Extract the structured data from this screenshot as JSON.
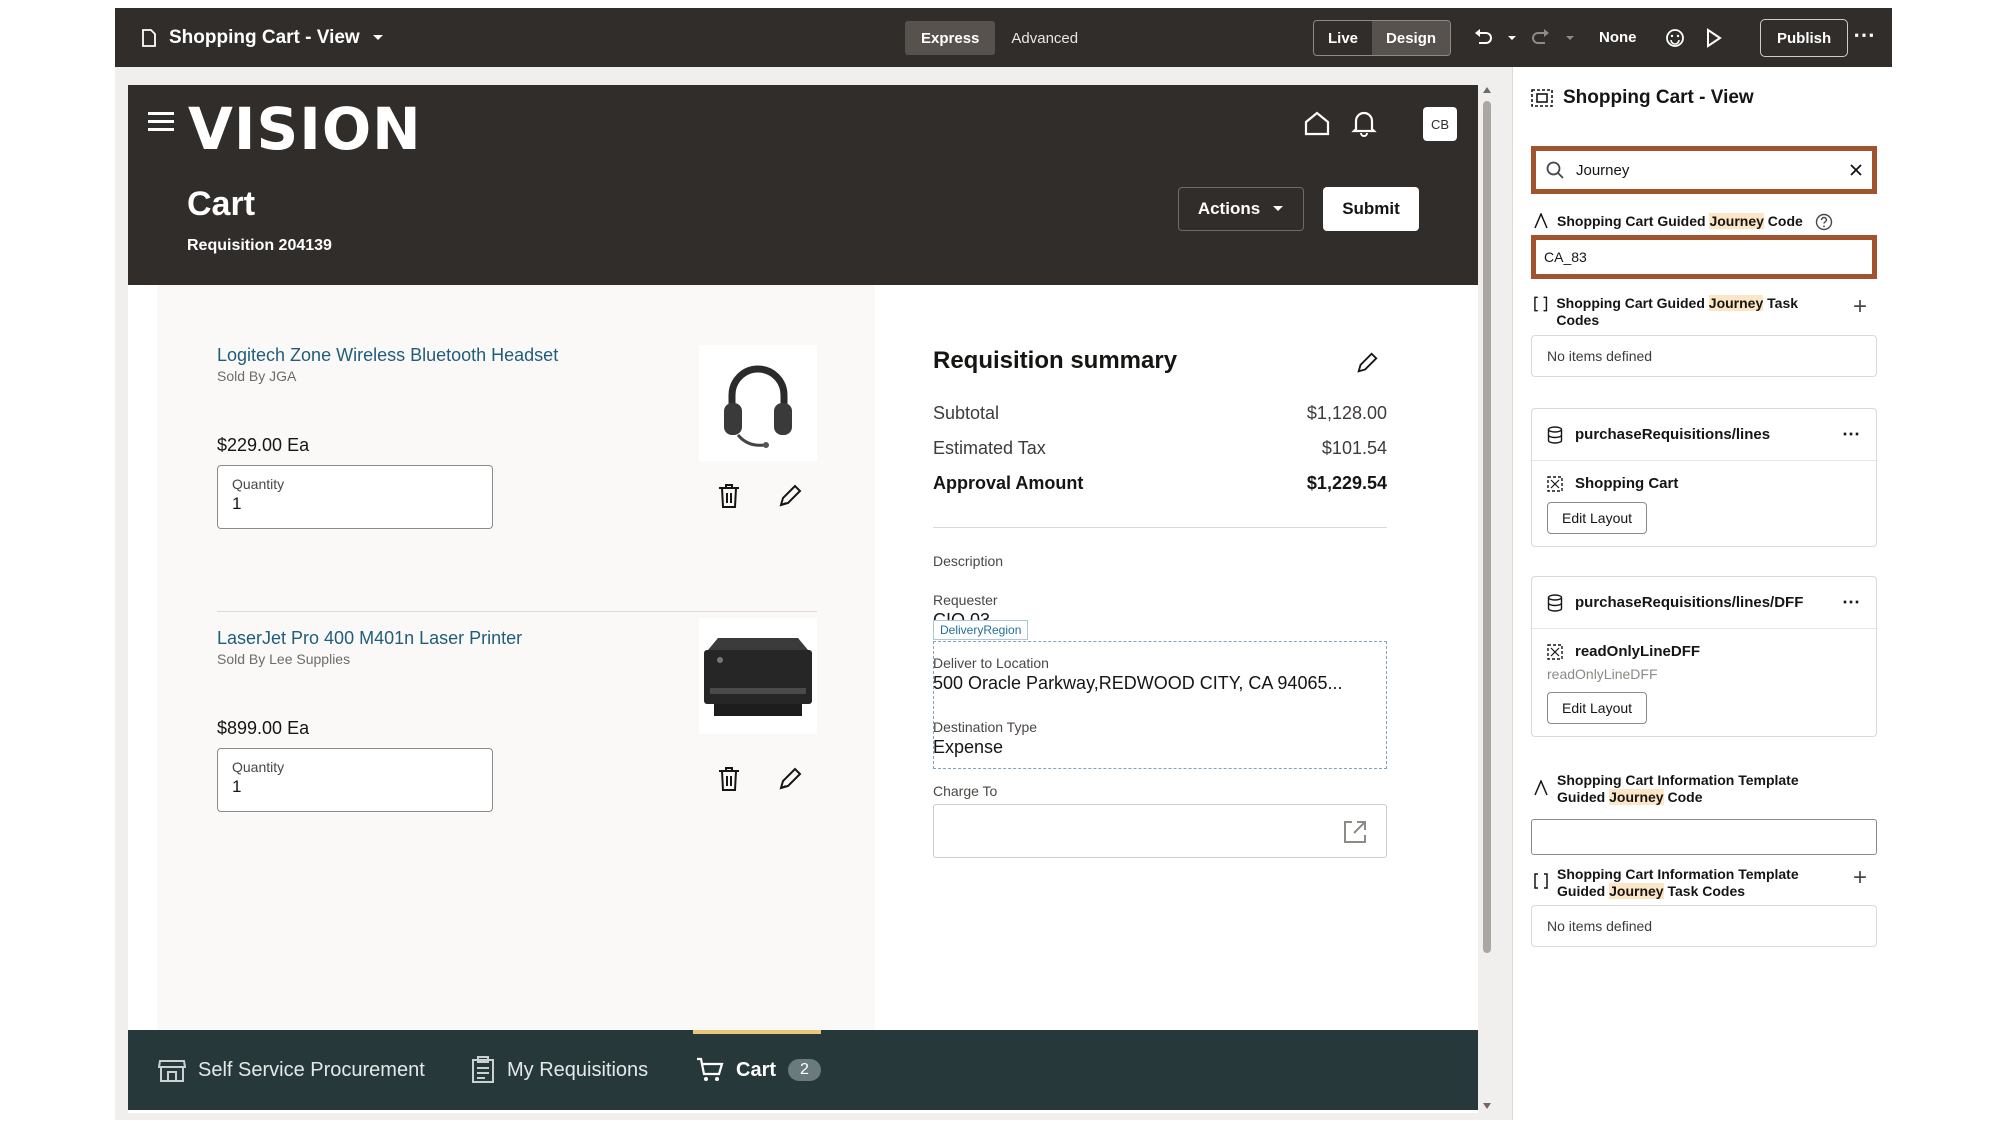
{
  "designer": {
    "page_title": "Shopping Cart - View",
    "segments": [
      "Express",
      "Advanced"
    ],
    "modes": [
      "Live",
      "Design"
    ],
    "none_label": "None",
    "publish_label": "Publish"
  },
  "app": {
    "logo": "VISION",
    "avatar": "CB",
    "title": "Cart",
    "subtitle": "Requisition 204139",
    "actions_label": "Actions",
    "submit_label": "Submit"
  },
  "items": [
    {
      "name": "Logitech Zone Wireless Bluetooth Headset",
      "sold_by": "Sold By JGA",
      "price": "$229.00 Ea",
      "qty_label": "Quantity",
      "qty": "1"
    },
    {
      "name": "LaserJet Pro 400 M401n Laser Printer",
      "sold_by": "Sold By Lee Supplies",
      "price": "$899.00 Ea",
      "qty_label": "Quantity",
      "qty": "1"
    }
  ],
  "summary": {
    "title": "Requisition summary",
    "subtotal_label": "Subtotal",
    "subtotal": "$1,128.00",
    "tax_label": "Estimated Tax",
    "tax": "$101.54",
    "approval_label": "Approval Amount",
    "approval": "$1,229.54",
    "description_label": "Description",
    "requester_label": "Requester",
    "requester_value": "CIO 03",
    "delivery_tag": "DeliveryRegion",
    "deliver_label": "Deliver to Location",
    "deliver_value": "500 Oracle Parkway,REDWOOD CITY, CA 94065...",
    "dest_label": "Destination Type",
    "dest_value": "Expense",
    "charge_label": "Charge To"
  },
  "nav": {
    "self_service": "Self Service Procurement",
    "my_requisitions": "My Requisitions",
    "cart": "Cart",
    "cart_count": "2"
  },
  "panel": {
    "title": "Shopping Cart - View",
    "search_value": "Journey",
    "prop1": {
      "pre": "Shopping Cart Guided ",
      "hl": "Journey",
      "post": " Code",
      "value": "CA_83"
    },
    "prop2": {
      "pre": "Shopping Cart Guided ",
      "hl": "Journey",
      "post": " Task Codes",
      "empty": "No items defined"
    },
    "card1": {
      "title": "purchaseRequisitions/lines",
      "sub": "Shopping Cart",
      "button": "Edit Layout"
    },
    "card2": {
      "title": "purchaseRequisitions/lines/DFF",
      "sub": "readOnlyLineDFF",
      "note": "readOnlyLineDFF",
      "button": "Edit Layout"
    },
    "prop3": {
      "line1": "Shopping Cart Information Template",
      "pre": "Guided ",
      "hl": "Journey",
      "post": " Code"
    },
    "prop4": {
      "line1": "Shopping Cart Information Template",
      "pre": "Guided ",
      "hl": "Journey",
      "post": " Task Codes",
      "empty": "No items defined"
    }
  }
}
